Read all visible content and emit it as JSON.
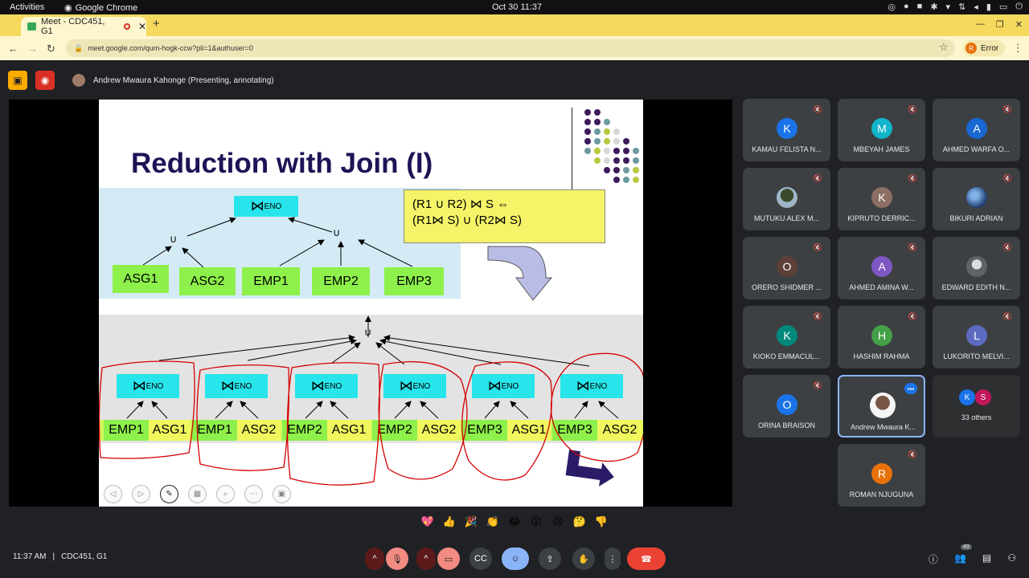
{
  "system_bar": {
    "activities": "Activities",
    "app_name": "Google Chrome",
    "datetime": "Oct 30  11:37"
  },
  "browser": {
    "tab_title": "Meet - CDC451, G1",
    "url": "meet.google.com/qum-hogk-ccw?pli=1&authuser=0",
    "profile_label": "Error",
    "profile_initial": "R"
  },
  "meet": {
    "presenter_label": "Andrew Mwaura Kahonge (Presenting, annotating)",
    "meeting_time": "11:37 AM",
    "meeting_code": "CDC451, G1"
  },
  "slide": {
    "title": "Reduction with Join (I)",
    "top_join_label": "ENO",
    "union_symbol": "∪",
    "top_relations": [
      "ASG1",
      "ASG2",
      "EMP1",
      "EMP2",
      "EMP3"
    ],
    "formula_line1": "(R1 ∪ R2) ⋈ S  ⇔",
    "formula_line2": "(R1⋈ S) ∪ (R2⋈  S)",
    "join_label": "ENO",
    "bowtie": "⋈",
    "pairs": [
      {
        "left": "EMP1",
        "right": "ASG1"
      },
      {
        "left": "EMP1",
        "right": "ASG2"
      },
      {
        "left": "EMP2",
        "right": "ASG1"
      },
      {
        "left": "EMP2",
        "right": "ASG2"
      },
      {
        "left": "EMP3",
        "right": "ASG1"
      },
      {
        "left": "EMP3",
        "right": "ASG2"
      }
    ]
  },
  "participants": [
    {
      "initial": "K",
      "name": "KAMAU FELISTA N...",
      "color": "#1a73e8"
    },
    {
      "initial": "M",
      "name": "MBEYAH JAMES",
      "color": "#12b5cb"
    },
    {
      "initial": "A",
      "name": "AHMED WARFA O...",
      "color": "#1967d2"
    },
    {
      "initial": "",
      "name": "MUTUKU ALEX M...",
      "color": "#5f6f52"
    },
    {
      "initial": "K",
      "name": "KIPRUTO DERRIC...",
      "color": "#8d6e63"
    },
    {
      "initial": "",
      "name": "BIKURI ADRIAN",
      "color": "#3f6ea8"
    },
    {
      "initial": "O",
      "name": "ORERO SHIDMER ...",
      "color": "#5d4037"
    },
    {
      "initial": "A",
      "name": "AHMED AMINA W...",
      "color": "#7e57c2"
    },
    {
      "initial": "",
      "name": "EDWARD EDITH N...",
      "color": "#5f6368"
    },
    {
      "initial": "K",
      "name": "KIOKO EMMACUL...",
      "color": "#00897b"
    },
    {
      "initial": "H",
      "name": "HASHIM RAHMA",
      "color": "#43a047"
    },
    {
      "initial": "L",
      "name": "LUKORITO MELVI...",
      "color": "#5c6bc0"
    },
    {
      "initial": "O",
      "name": "ORINA BRAISON",
      "color": "#1a73e8"
    },
    {
      "initial": "",
      "name": "Andrew Mwaura K...",
      "color": "#eeeeee"
    },
    {
      "initial": "",
      "name": "33 others",
      "color": "#3c4043"
    },
    {
      "initial": "R",
      "name": "ROMAN NJUGUNA",
      "color": "#e8710a"
    }
  ],
  "others_avatars": [
    {
      "initial": "K",
      "color": "#1a73e8"
    },
    {
      "initial": "S",
      "color": "#c2185b"
    }
  ],
  "reactions": [
    "💖",
    "👍",
    "🎉",
    "👏",
    "😂",
    "😮",
    "😢",
    "🤔",
    "👎"
  ],
  "controls": {
    "badge_count": "49"
  }
}
